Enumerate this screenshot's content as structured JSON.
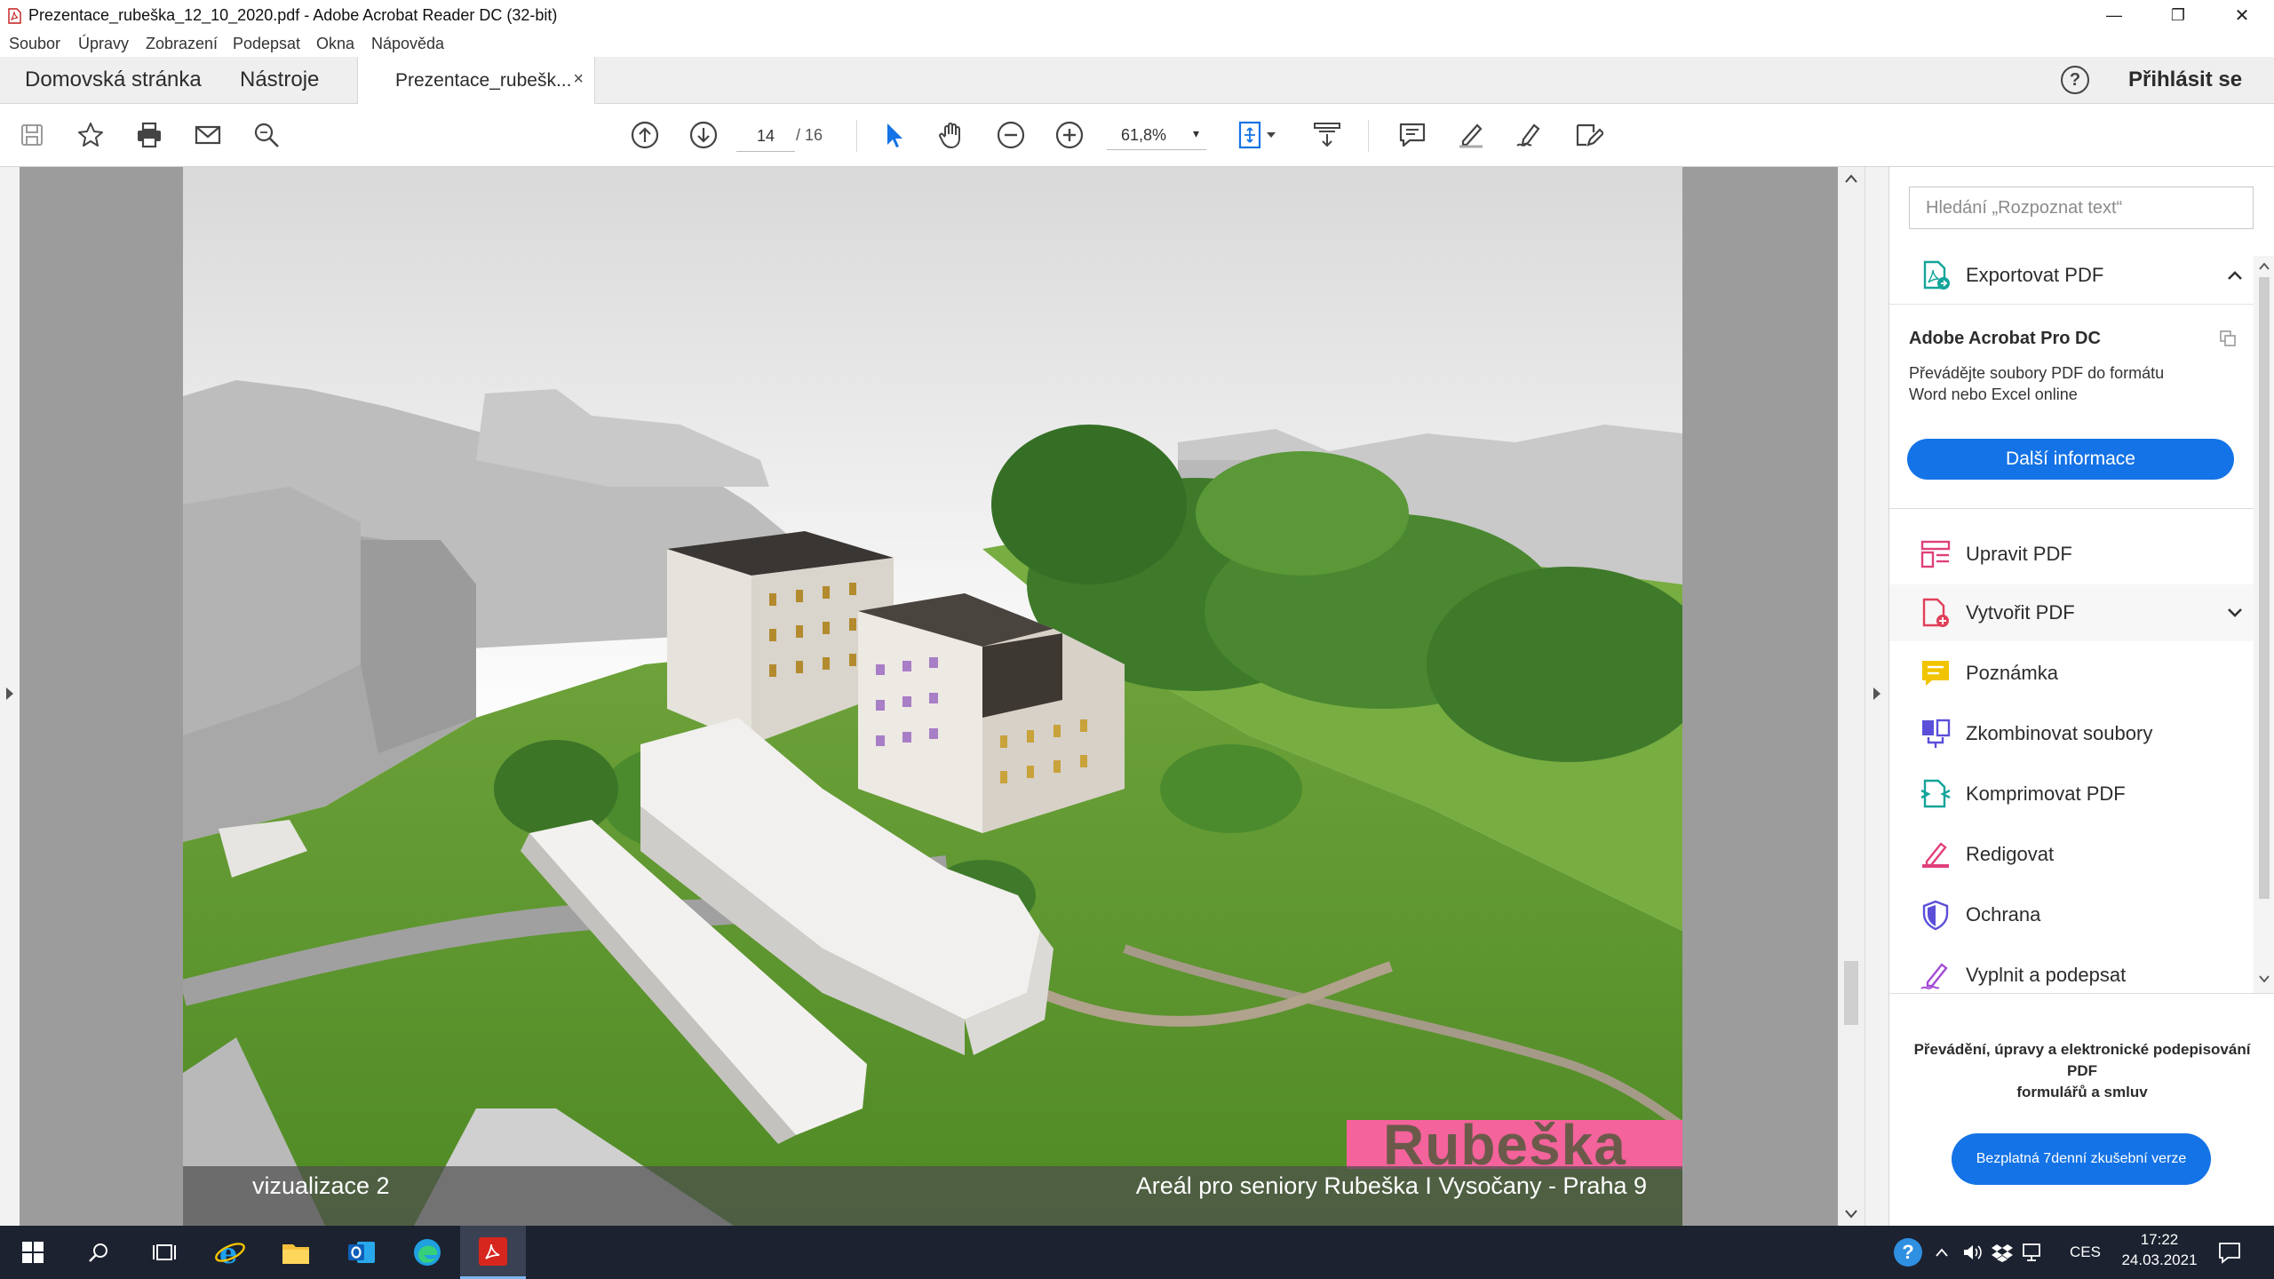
{
  "window": {
    "title": "Prezentace_rubeška_12_10_2020.pdf - Adobe Acrobat Reader DC (32-bit)",
    "minimize_glyph": "—",
    "restore_glyph": "❐",
    "close_glyph": "✕"
  },
  "menu": [
    "Soubor",
    "Úpravy",
    "Zobrazení",
    "Podepsat",
    "Okna",
    "Nápověda"
  ],
  "tabs": {
    "home": "Domovská stránka",
    "tools": "Nástroje",
    "document": "Prezentace_rubešk...",
    "close_glyph": "×",
    "help_glyph": "?",
    "sign_in": "Přihlásit se"
  },
  "toolbar": {
    "page_current": "14",
    "page_total": "/ 16",
    "zoom": "61,8%",
    "zoom_caret": "▾"
  },
  "document": {
    "caption_left": "vizualizace 2",
    "caption_right": "Areál pro seniory Rubeška I Vysočany - Praha 9",
    "logo_text": "Rubeška",
    "logo_colors": {
      "block": "#f4639b",
      "text": "#6b5a4a"
    }
  },
  "right_pane": {
    "search_placeholder": "Hledání „Rozpoznat text“",
    "export": {
      "title": "Exportovat PDF",
      "product": "Adobe Acrobat Pro DC",
      "desc_line1": "Převádějte soubory PDF do formátu",
      "desc_line2": "Word nebo Excel online",
      "cta": "Další informace"
    },
    "tools": [
      {
        "label": "Upravit PDF",
        "icon": "edit-pdf-icon",
        "color": "#e0407b"
      },
      {
        "label": "Vytvořit PDF",
        "icon": "create-pdf-icon",
        "color": "#e0405a"
      },
      {
        "label": "Poznámka",
        "icon": "comment-icon",
        "color": "#f2c300"
      },
      {
        "label": "Zkombinovat soubory",
        "icon": "combine-files-icon",
        "color": "#5b4fd9"
      },
      {
        "label": "Komprimovat PDF",
        "icon": "compress-pdf-icon",
        "color": "#13a49a"
      },
      {
        "label": "Redigovat",
        "icon": "redact-icon",
        "color": "#e0407b"
      },
      {
        "label": "Ochrana",
        "icon": "protect-icon",
        "color": "#5b4fd9"
      },
      {
        "label": "Vyplnit a podepsat",
        "icon": "fill-sign-icon",
        "color": "#a34bd6"
      }
    ],
    "promo_line1": "Převádění, úpravy a elektronické podepisování",
    "promo_line2": "PDF",
    "promo_line3": "formulářů a smluv",
    "trial_button": "Bezplatná 7denní zkušební verze",
    "accent": "#1473e6"
  },
  "taskbar": {
    "language": "CES",
    "time": "17:22",
    "date": "24.03.2021"
  }
}
